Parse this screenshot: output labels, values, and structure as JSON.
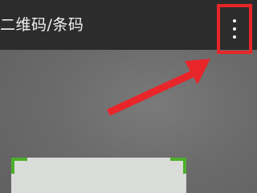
{
  "app_bar": {
    "title": "二维码/条码",
    "more_icon": "more-vert-icon"
  },
  "annotation": {
    "arrow_color": "#e8262a",
    "highlight_color": "#e8262a"
  },
  "scanner": {
    "corner_color": "#4caf2a"
  }
}
